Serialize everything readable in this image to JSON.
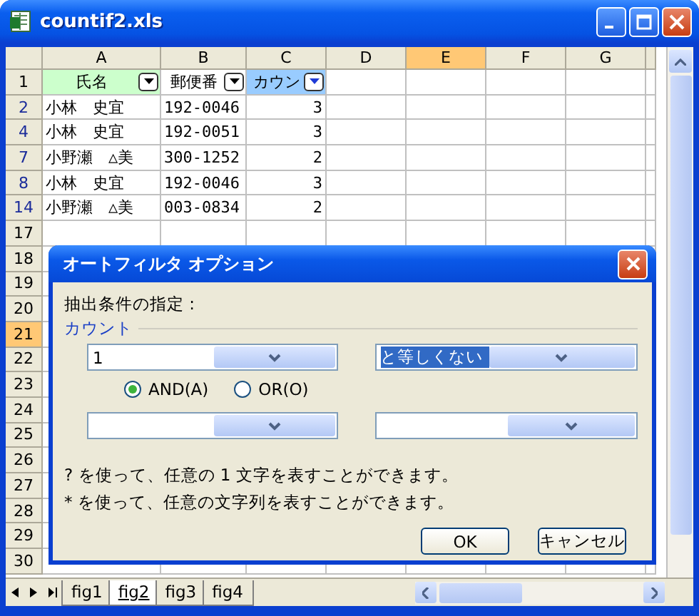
{
  "window": {
    "title": "countif2.xls"
  },
  "columns": [
    {
      "label": "A",
      "selected": false
    },
    {
      "label": "B",
      "selected": false
    },
    {
      "label": "C",
      "selected": false
    },
    {
      "label": "D",
      "selected": false
    },
    {
      "label": "E",
      "selected": true
    },
    {
      "label": "F",
      "selected": false
    },
    {
      "label": "G",
      "selected": false
    }
  ],
  "header_row": {
    "number": "1",
    "cells": [
      {
        "text": "氏名",
        "color": "#ccffcc",
        "filter_active": false
      },
      {
        "text": "郵便番",
        "color": "#ffffff",
        "filter_active": false
      },
      {
        "text": "カウン",
        "color": "#99ccff",
        "filter_active": true
      }
    ]
  },
  "rows": [
    {
      "number": "2",
      "filtered": true,
      "selected": false,
      "cells": [
        "小林　史宜",
        "192-0046",
        "3"
      ]
    },
    {
      "number": "4",
      "filtered": true,
      "selected": false,
      "cells": [
        "小林　史宜",
        "192-0051",
        "3"
      ]
    },
    {
      "number": "7",
      "filtered": true,
      "selected": false,
      "cells": [
        "小野瀬　△美",
        "300-1252",
        "2"
      ]
    },
    {
      "number": "8",
      "filtered": true,
      "selected": false,
      "cells": [
        "小林　史宜",
        "192-0046",
        "3"
      ]
    },
    {
      "number": "14",
      "filtered": true,
      "selected": false,
      "cells": [
        "小野瀬　△美",
        "003-0834",
        "2"
      ]
    },
    {
      "number": "17",
      "filtered": false,
      "selected": false
    },
    {
      "number": "18",
      "filtered": false,
      "selected": false
    },
    {
      "number": "19",
      "filtered": false,
      "selected": false
    },
    {
      "number": "20",
      "filtered": false,
      "selected": false
    },
    {
      "number": "21",
      "filtered": false,
      "selected": true
    },
    {
      "number": "22",
      "filtered": false,
      "selected": false
    },
    {
      "number": "23",
      "filtered": false,
      "selected": false
    },
    {
      "number": "24",
      "filtered": false,
      "selected": false
    },
    {
      "number": "25",
      "filtered": false,
      "selected": false
    },
    {
      "number": "26",
      "filtered": false,
      "selected": false
    },
    {
      "number": "27",
      "filtered": false,
      "selected": false
    },
    {
      "number": "28",
      "filtered": false,
      "selected": false
    },
    {
      "number": "29",
      "filtered": false,
      "selected": false
    },
    {
      "number": "30",
      "filtered": false,
      "selected": false
    }
  ],
  "dialog": {
    "title": "オートフィルタ オプション",
    "prompt": "抽出条件の指定 :",
    "field_label": "カウント",
    "conditions": [
      {
        "value": "1",
        "operator": "と等しくない",
        "operator_selected": true
      },
      {
        "operator_selected": false
      }
    ],
    "logic": [
      {
        "label": "AND(A)",
        "selected": true
      },
      {
        "label": "OR(O)",
        "selected": false
      }
    ],
    "hints": [
      "? を使って、任意の 1 文字を表すことができます。",
      "* を使って、任意の文字列を表すことができます。"
    ],
    "buttons": [
      "OK",
      "キャンセル"
    ]
  },
  "sheet_tabs": [
    {
      "label": "fig1",
      "selected": false
    },
    {
      "label": "fig2",
      "selected": true
    },
    {
      "label": "fig3",
      "selected": false
    },
    {
      "label": "fig4",
      "selected": false
    }
  ]
}
